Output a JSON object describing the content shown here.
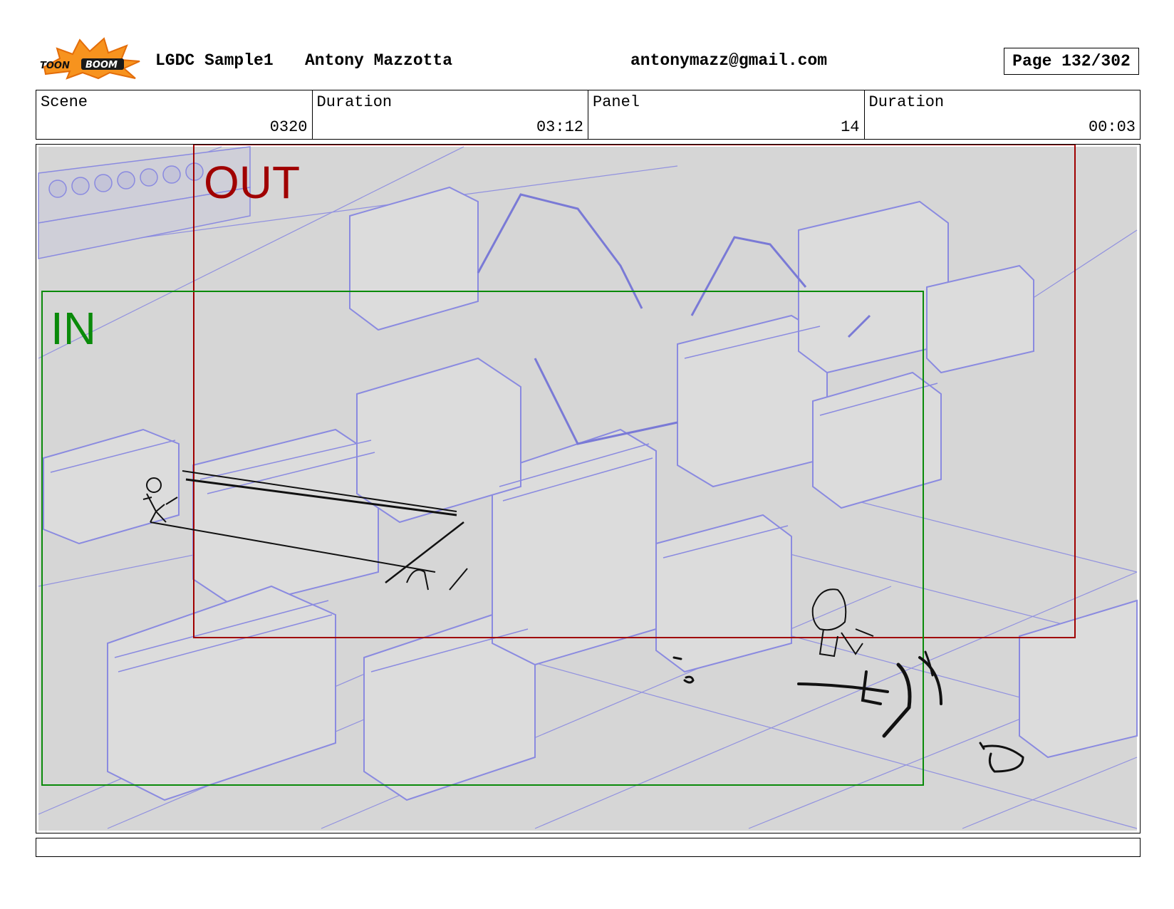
{
  "header": {
    "logo_text": "TOONBOOM",
    "project": "LGDC Sample1",
    "author": "Antony Mazzotta",
    "email": "antonymazz@gmail.com",
    "page": "Page 132/302"
  },
  "info": [
    {
      "label": "Scene",
      "value": "0320"
    },
    {
      "label": "Duration",
      "value": "03:12"
    },
    {
      "label": "Panel",
      "value": "14"
    },
    {
      "label": "Duration",
      "value": "00:03"
    }
  ],
  "panel": {
    "in_label": "IN",
    "out_label": "OUT",
    "in_color": "#0a8a0a",
    "out_color": "#a00000",
    "wireframe_color": "#8a8ae0",
    "background_color": "#d6d6d6"
  },
  "caption": {
    "text": ""
  }
}
